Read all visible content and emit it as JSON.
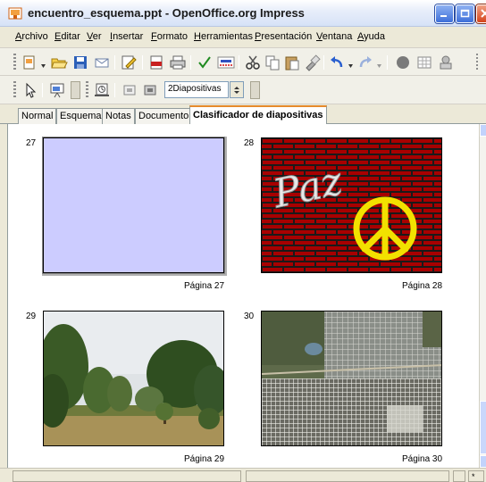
{
  "window": {
    "title": "encuentro_esquema.ppt - OpenOffice.org Impress"
  },
  "menu": [
    "Archivo",
    "Editar",
    "Ver",
    "Insertar",
    "Formato",
    "Herramientas",
    "Presentación",
    "Ventana",
    "Ayuda"
  ],
  "toolbar2": {
    "slides_per_row_value": "2Diapositivas"
  },
  "tabs": [
    "Normal",
    "Esquema",
    "Notas",
    "Documento",
    "Clasificador de diapositivas"
  ],
  "active_tab": "Clasificador de diapositivas",
  "slides": [
    {
      "number": "27",
      "page_label": "Página 27",
      "content": "blank-lavender",
      "selected": true
    },
    {
      "number": "28",
      "page_label": "Página 28",
      "content": "brick-wall-graffiti"
    },
    {
      "number": "29",
      "page_label": "Página 29",
      "content": "park-photo"
    },
    {
      "number": "30",
      "page_label": "Página 30",
      "content": "aerial-city-photo"
    }
  ],
  "slide_28_graffiti_text": "Paz",
  "statusbar": {
    "marker": "*"
  },
  "colors": {
    "accent_tab": "#e68b2c",
    "slide27_bg": "#ccccff",
    "brick": "#a80000",
    "peace_sign": "#f2e100"
  }
}
